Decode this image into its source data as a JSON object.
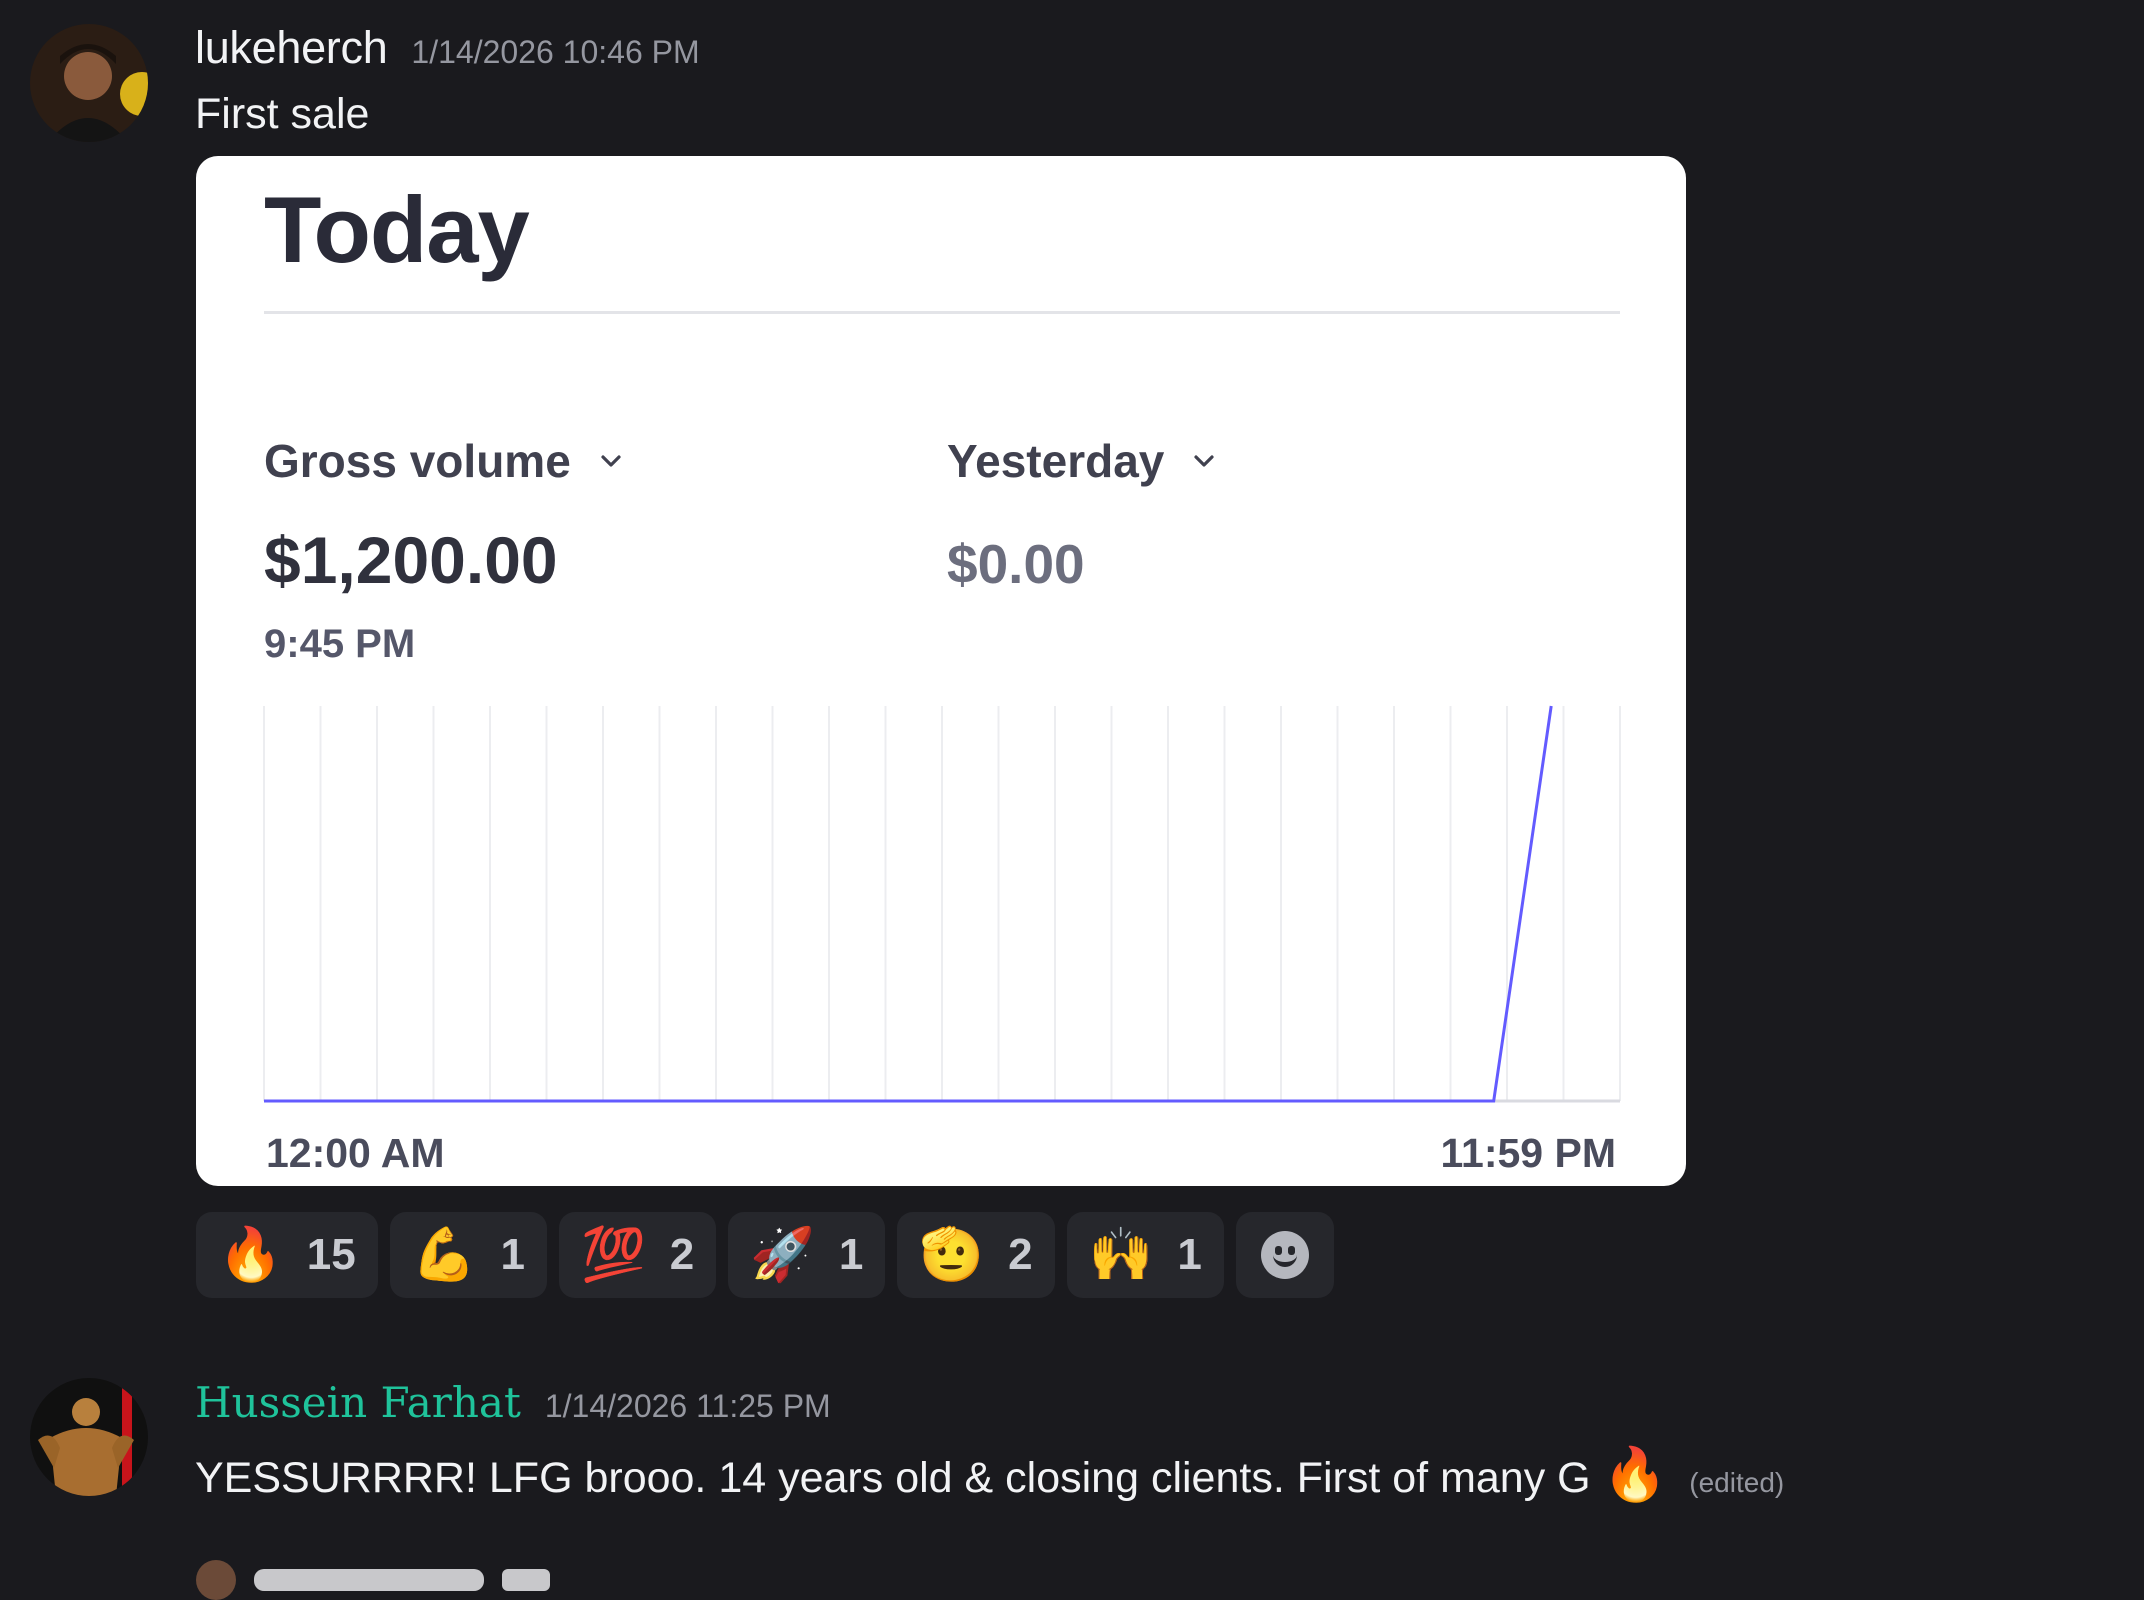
{
  "messages": [
    {
      "author": "lukeherch",
      "timestamp": "1/14/2026 10:46 PM",
      "text": "First sale",
      "attachment": {
        "title": "Today",
        "metric_label": "Gross volume",
        "metric_value": "$1,200.00",
        "metric_time": "9:45 PM",
        "compare_label": "Yesterday",
        "compare_value": "$0.00",
        "x_start": "12:00 AM",
        "x_end": "11:59 PM"
      },
      "reactions": [
        {
          "emoji": "🔥",
          "count": "15"
        },
        {
          "emoji": "💪",
          "count": "1"
        },
        {
          "emoji": "💯",
          "count": "2"
        },
        {
          "emoji": "🚀",
          "count": "1"
        },
        {
          "emoji": "🫡",
          "count": "2"
        },
        {
          "emoji": "🙌",
          "count": "1"
        }
      ]
    },
    {
      "author": "Hussein Farhat",
      "timestamp": "1/14/2026 11:25 PM",
      "text": "YESSURRRR! LFG brooo. 14 years old & closing clients. First of many G",
      "text_emoji": "🔥",
      "edited": "(edited)"
    }
  ],
  "chart_data": {
    "type": "line",
    "series": [
      {
        "color": "#635bff",
        "x": [
          "12:00 AM",
          "9:45 PM",
          "10:46 PM"
        ],
        "values": [
          0,
          0,
          1200
        ]
      }
    ],
    "xlabel": "",
    "ylabel": "",
    "x_ticks": [
      "12:00 AM",
      "11:59 PM"
    ],
    "grid": true,
    "legend": "none"
  }
}
